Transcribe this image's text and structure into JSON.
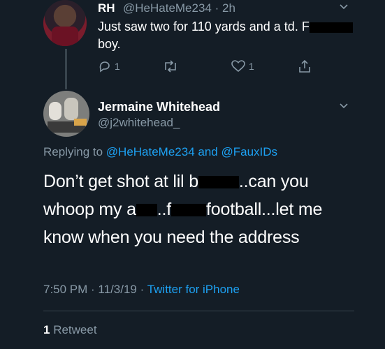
{
  "parent_tweet": {
    "name": "RH",
    "handle_time": "@HeHateMe234 · 2h",
    "text_before_redaction": "Just saw two for 110 yards and a td. F",
    "text_after_redaction": "boy.",
    "reply_count": "1",
    "like_count": "1"
  },
  "main_tweet": {
    "name": "Jermaine Whitehead",
    "handle": "@j2whitehead_",
    "replying_prefix": "Replying to ",
    "replying_to_1": "@HeHateMe234",
    "replying_and": " and ",
    "replying_to_2": "@FauxIDs",
    "body": {
      "part1": "Don’t get shot at lil b",
      "part2": "..can you",
      "part3": "whoop my a",
      "part4": "..f",
      "part5": "football...let me",
      "part6": "know when you need the address"
    },
    "time_date": "7:50 PM · 11/3/19 · ",
    "source": "Twitter for iPhone",
    "retweet_count": "1",
    "retweet_label": " Retweet"
  },
  "icons": {
    "reply": "reply-icon",
    "retweet": "retweet-icon",
    "like": "heart-icon",
    "share": "share-icon",
    "caret": "chevron-down-icon"
  },
  "colors": {
    "background": "#141d26",
    "accent": "#1da1f2",
    "muted": "#8899a6"
  }
}
